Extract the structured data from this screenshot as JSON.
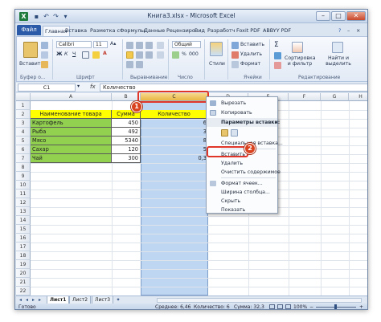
{
  "window": {
    "title": "Книга3.xlsx - Microsoft Excel",
    "minimize": "–",
    "maximize": "□",
    "close": "✕"
  },
  "qat": {
    "save_icon": "save-icon",
    "undo_icon": "undo-icon",
    "redo_icon": "redo-icon"
  },
  "tabs": [
    "Файл",
    "Главная",
    "Вставка",
    "Разметка с",
    "Формулы",
    "Данные",
    "Рецензиро",
    "Вид",
    "Разработч",
    "Foxit PDF",
    "ABBYY PDF"
  ],
  "ribbon": {
    "paste": "Вставить",
    "clipboard": "Буфер о...",
    "font_name": "Calibri",
    "font_size": "11",
    "font_group": "Шрифт",
    "align_group": "Выравнивание",
    "number_format": "Общий",
    "number_group": "Число",
    "styles": "Стили",
    "cells_insert": "Вставить",
    "cells_delete": "Удалить",
    "cells_format": "Формат",
    "cells_group": "Ячейки",
    "sort_filter": "Сортировка и фильтр",
    "find_select": "Найти и выделить",
    "editing_group": "Редактирование"
  },
  "formula_bar": {
    "name_box": "C1",
    "fx": "fx",
    "content": "Количество"
  },
  "columns": [
    "A",
    "B",
    "C",
    "D",
    "E",
    "F",
    "G",
    "H"
  ],
  "rows": [
    "1",
    "2",
    "3",
    "4",
    "5",
    "6",
    "7",
    "8",
    "9",
    "10",
    "11",
    "12",
    "13",
    "14",
    "15",
    "16",
    "17",
    "18",
    "19",
    "20",
    "21",
    "22"
  ],
  "table": {
    "header": [
      "Наименование товара",
      "Сумма",
      "Количество"
    ],
    "rows": [
      {
        "name": "Картофель",
        "sum": "450",
        "qty": "6"
      },
      {
        "name": "Рыба",
        "sum": "492",
        "qty": "3"
      },
      {
        "name": "Мясо",
        "sum": "5340",
        "qty": "8"
      },
      {
        "name": "Сахар",
        "sum": "120",
        "qty": "5"
      },
      {
        "name": "Чай",
        "sum": "300",
        "qty": "0,3"
      }
    ]
  },
  "context_menu": {
    "cut": "Вырезать",
    "copy": "Копировать",
    "paste_options": "Параметры вставки:",
    "paste_special": "Специальная вставка...",
    "insert": "Вставить",
    "delete": "Удалить",
    "clear": "Очистить содержимое",
    "format_cells": "Формат ячеек...",
    "col_width": "Ширина столбца...",
    "hide": "Скрыть",
    "show": "Показать"
  },
  "callouts": [
    "1",
    "2"
  ],
  "sheets": [
    "Лист1",
    "Лист2",
    "Лист3"
  ],
  "status": {
    "ready": "Готово",
    "average": "Среднее: 6,46",
    "count": "Количество: 6",
    "sum": "Сумма: 32,3",
    "zoom": "100%"
  },
  "colors": {
    "green": "#92d050",
    "yellow": "#ffff00",
    "selection": "#bfd6f3",
    "callout": "#d9431f",
    "file_tab": "#2a5aa8"
  }
}
